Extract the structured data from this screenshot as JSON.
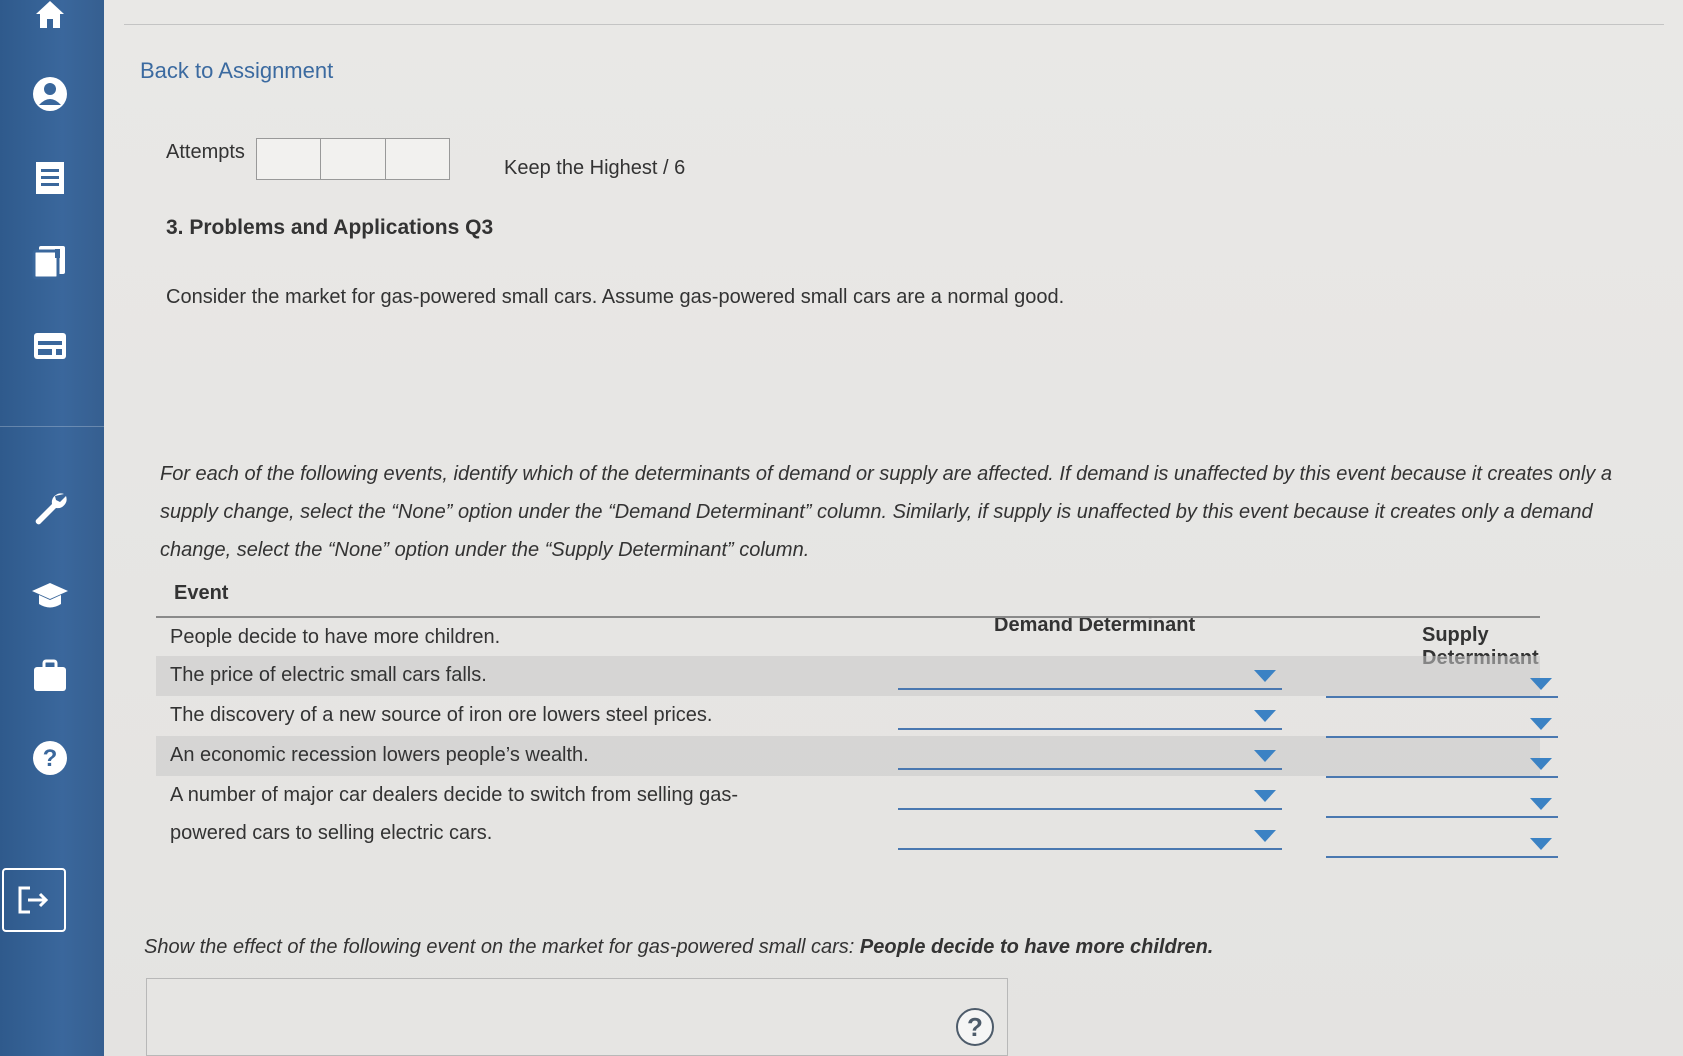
{
  "nav": {
    "items": [
      "home-icon",
      "user-icon",
      "list-icon",
      "book-icon",
      "card-icon",
      "wrench-icon",
      "graduation-cap-icon",
      "briefcase-icon",
      "help-icon"
    ],
    "exit_icon": "exit-icon"
  },
  "header": {
    "back_link": "Back to Assignment",
    "attempts_label": "Attempts",
    "keep_highest": "Keep the Highest / 6"
  },
  "question": {
    "title": "3. Problems and Applications Q3",
    "intro": "Consider the market for gas-powered small cars. Assume gas-powered small cars are a normal good.",
    "instructions": "For each of the following events, identify which of the determinants of demand or supply are affected. If demand is unaffected by this event because it creates only a supply change, select the “None” option under the “Demand Determinant” column. Similarly, if supply is unaffected by this event because it creates only a demand change, select the “None” option under the “Supply Determinant” column."
  },
  "table": {
    "headers": {
      "event": "Event",
      "demand": "Demand Determinant",
      "supply": "Supply Determinant"
    },
    "rows": [
      {
        "event": "People decide to have more children.",
        "demand": "",
        "supply": ""
      },
      {
        "event": "The price of electric small cars falls.",
        "demand": "",
        "supply": ""
      },
      {
        "event": "The discovery of a new source of iron ore lowers steel prices.",
        "demand": "",
        "supply": ""
      },
      {
        "event": "An economic recession lowers people’s wealth.",
        "demand": "",
        "supply": ""
      },
      {
        "event": "A number of major car dealers decide to switch from selling gas-powered cars to selling electric cars.",
        "demand": "",
        "supply": ""
      }
    ]
  },
  "effect": {
    "prefix": "Show the effect of the following event on the market for gas-powered small cars: ",
    "event": "People decide to have more children.",
    "help_symbol": "?"
  },
  "colors": {
    "sidebar": "#3a679c",
    "link": "#3b6aa0",
    "dropdown_arrow": "#3b82c4"
  }
}
